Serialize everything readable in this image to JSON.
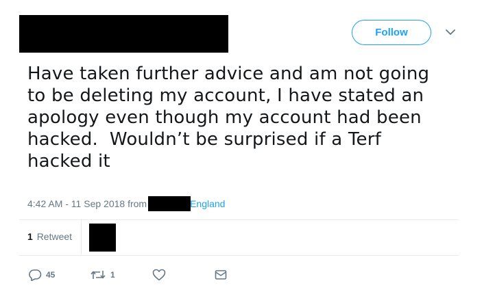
{
  "header": {
    "follow_label": "Follow"
  },
  "tweet": {
    "text": "Have taken further advice and am not going\nto be deleting my account, I have stated an\napology even though my account had been\nhacked.  Wouldn’t be surprised if a Terf\nhacked it",
    "timestamp": "4:42 AM - 11 Sep 2018 from",
    "location": "England"
  },
  "stats": {
    "retweet_count": "1",
    "retweet_label": "Retweet"
  },
  "actions": {
    "reply_count": "45",
    "retweet_count": "1"
  },
  "icons": {
    "reply": "reply-icon",
    "retweet": "retweet-icon",
    "like": "heart-icon",
    "dm": "envelope-icon",
    "more": "chevron-down-icon"
  },
  "colors": {
    "accent": "#1da1f2",
    "muted": "#657786",
    "text": "#14171a",
    "divider": "#e6ecf0"
  }
}
